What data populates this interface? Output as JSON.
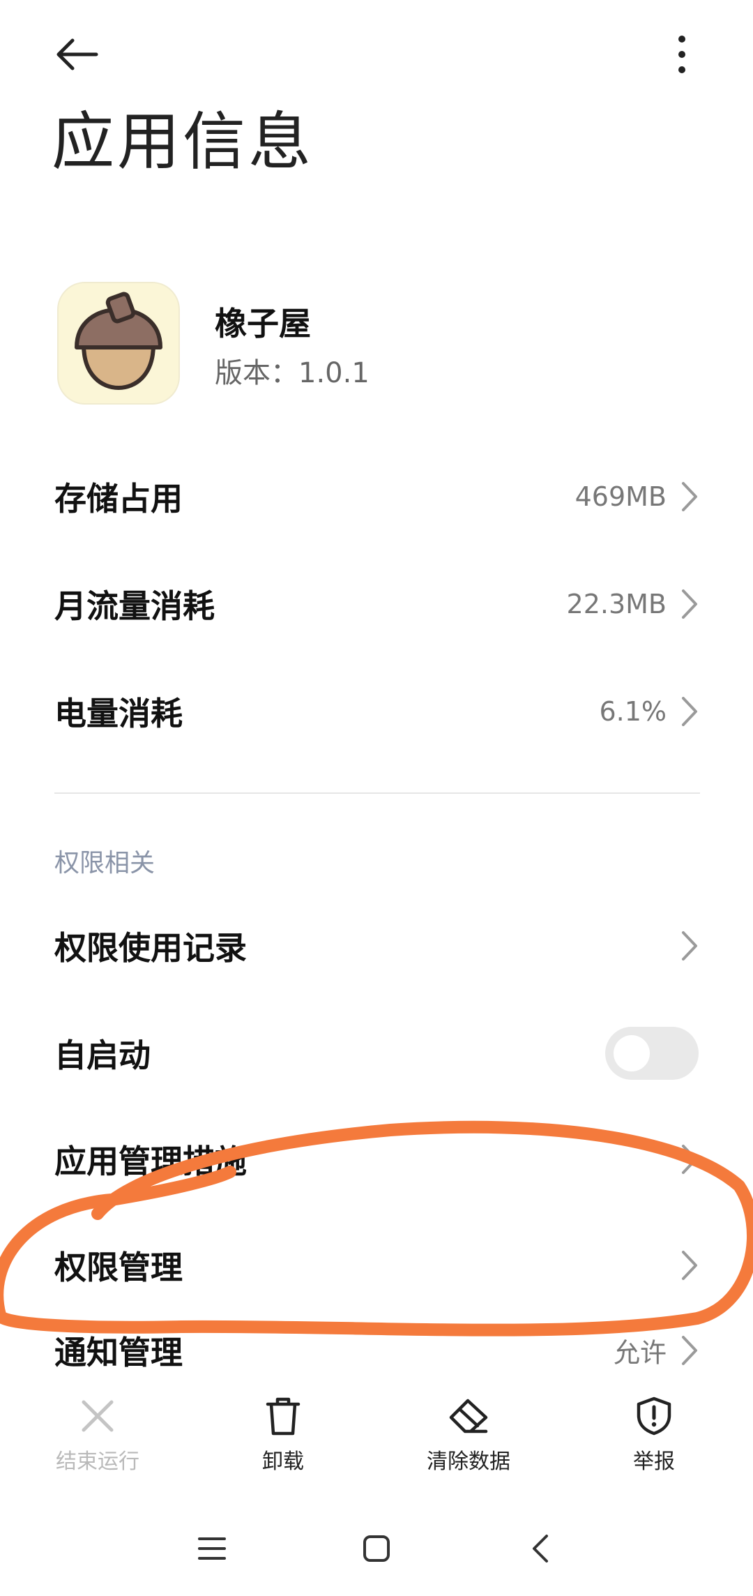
{
  "header": {
    "title": "应用信息",
    "back_icon": "arrow-left-icon",
    "more_icon": "more-vertical-icon"
  },
  "app": {
    "name": "橡子屋",
    "version": "版本：1.0.1",
    "icon": "acorn-app-icon"
  },
  "usage": [
    {
      "label": "存储占用",
      "value": "469MB"
    },
    {
      "label": "月流量消耗",
      "value": "22.3MB"
    },
    {
      "label": "电量消耗",
      "value": "6.1%"
    }
  ],
  "permissions_section": {
    "title": "权限相关",
    "items": [
      {
        "label": "权限使用记录"
      },
      {
        "label": "自启动",
        "toggle_on": false
      },
      {
        "label": "应用管理措施"
      },
      {
        "label": "权限管理"
      },
      {
        "label": "通知管理",
        "value": "允许"
      }
    ]
  },
  "actions": [
    {
      "label": "结束运行",
      "icon": "close-icon",
      "enabled": false
    },
    {
      "label": "卸载",
      "icon": "trash-icon",
      "enabled": true
    },
    {
      "label": "清除数据",
      "icon": "eraser-icon",
      "enabled": true
    },
    {
      "label": "举报",
      "icon": "shield-alert-icon",
      "enabled": true
    }
  ],
  "system_nav": [
    "menu-icon",
    "home-icon",
    "back-icon"
  ],
  "colors": {
    "annotation": "#f47a3c",
    "section_title": "#8a94a8",
    "app_icon_bg": "#fbf6d7"
  }
}
